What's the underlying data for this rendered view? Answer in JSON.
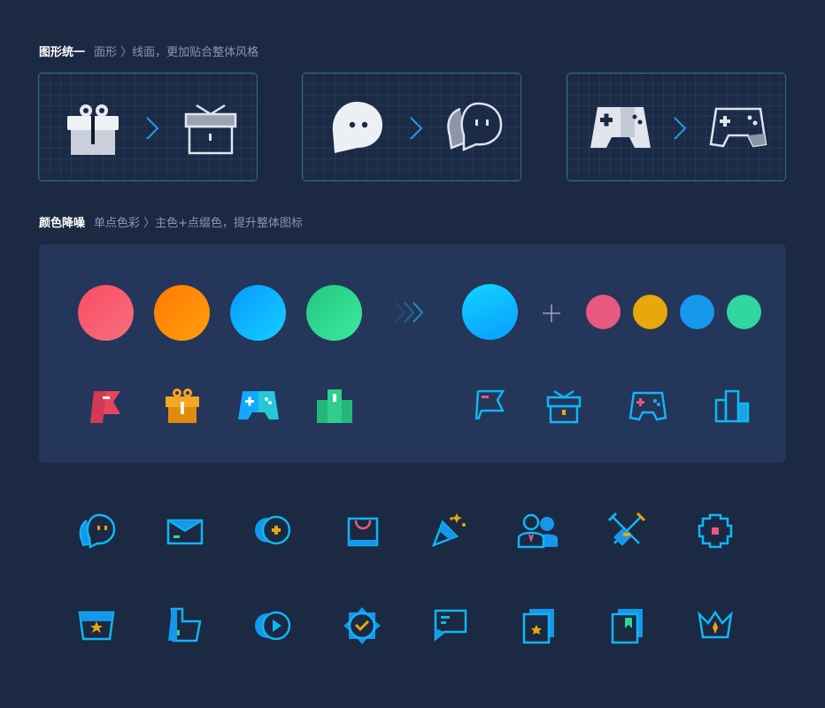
{
  "section1": {
    "title": "图形统一",
    "subtitle": "面形 〉线面，更加贴合整体风格",
    "examples": [
      {
        "from_icon": "gift-filled-icon",
        "to_icon": "gift-outline-icon"
      },
      {
        "from_icon": "chat-filled-icon",
        "to_icon": "chat-outline-icon"
      },
      {
        "from_icon": "gamepad-filled-icon",
        "to_icon": "gamepad-outline-icon"
      }
    ]
  },
  "section2": {
    "title": "颜色降噪",
    "subtitle": "单点色彩 〉主色+点缀色，提升整体图标",
    "before_colors": [
      "#f0556a",
      "#ff8a00",
      "#0bb6ff",
      "#2fd98f"
    ],
    "main_color": "#0bc0ff",
    "accent_colors": [
      "#e8587f",
      "#e6a80b",
      "#1597ec",
      "#2fd6a0"
    ],
    "before_icons": [
      "flag-icon",
      "gift-icon",
      "gamepad-icon",
      "podium-icon"
    ],
    "after_icons": [
      "flag-outline-icon",
      "gift-outline-icon",
      "gamepad-outline-icon",
      "podium-outline-icon"
    ]
  },
  "icon_grid": {
    "row1": [
      "chat-bubble-icon",
      "envelope-icon",
      "coin-icon",
      "shopping-bag-icon",
      "party-popper-icon",
      "users-icon",
      "swords-icon",
      "puzzle-icon"
    ],
    "row2": [
      "treasure-box-icon",
      "thumbs-up-icon",
      "video-play-icon",
      "badge-check-icon",
      "message-icon",
      "photo-stack-icon",
      "bookmark-book-icon",
      "crown-icon"
    ]
  }
}
